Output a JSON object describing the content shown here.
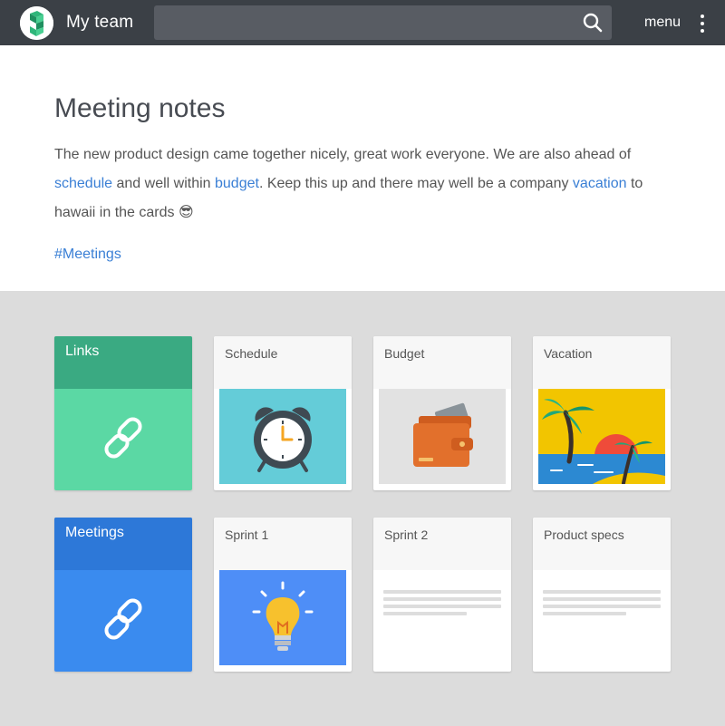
{
  "header": {
    "app_title": "My team",
    "search_placeholder": "",
    "menu_label": "menu"
  },
  "note": {
    "title": "Meeting notes",
    "text_1": "The new product design came together nicely,  great work everyone. We are also ahead of ",
    "link_schedule": "schedule",
    "text_2": " and well within ",
    "link_budget": "budget",
    "text_3": ". Keep this up and there may well be a company ",
    "link_vacation": "vacation",
    "text_4": " to hawaii in the cards ",
    "emoji": "😎",
    "tag": "#Meetings"
  },
  "cards": {
    "links": {
      "title": "Links",
      "icon": "link-icon",
      "head_color": "#3aaa82",
      "body_color": "#5bd8a4"
    },
    "schedule": {
      "title": "Schedule",
      "icon": "alarm-clock-icon"
    },
    "budget": {
      "title": "Budget",
      "icon": "wallet-icon"
    },
    "vacation": {
      "title": "Vacation",
      "icon": "palm-beach-icon"
    },
    "meetings": {
      "title": "Meetings",
      "icon": "link-icon",
      "head_color": "#2d78d8",
      "body_color": "#3a8bef"
    },
    "sprint1": {
      "title": "Sprint 1",
      "icon": "lightbulb-icon"
    },
    "sprint2": {
      "title": "Sprint 2",
      "icon": "document-lines-icon"
    },
    "product_specs": {
      "title": "Product specs",
      "icon": "document-lines-icon"
    }
  }
}
